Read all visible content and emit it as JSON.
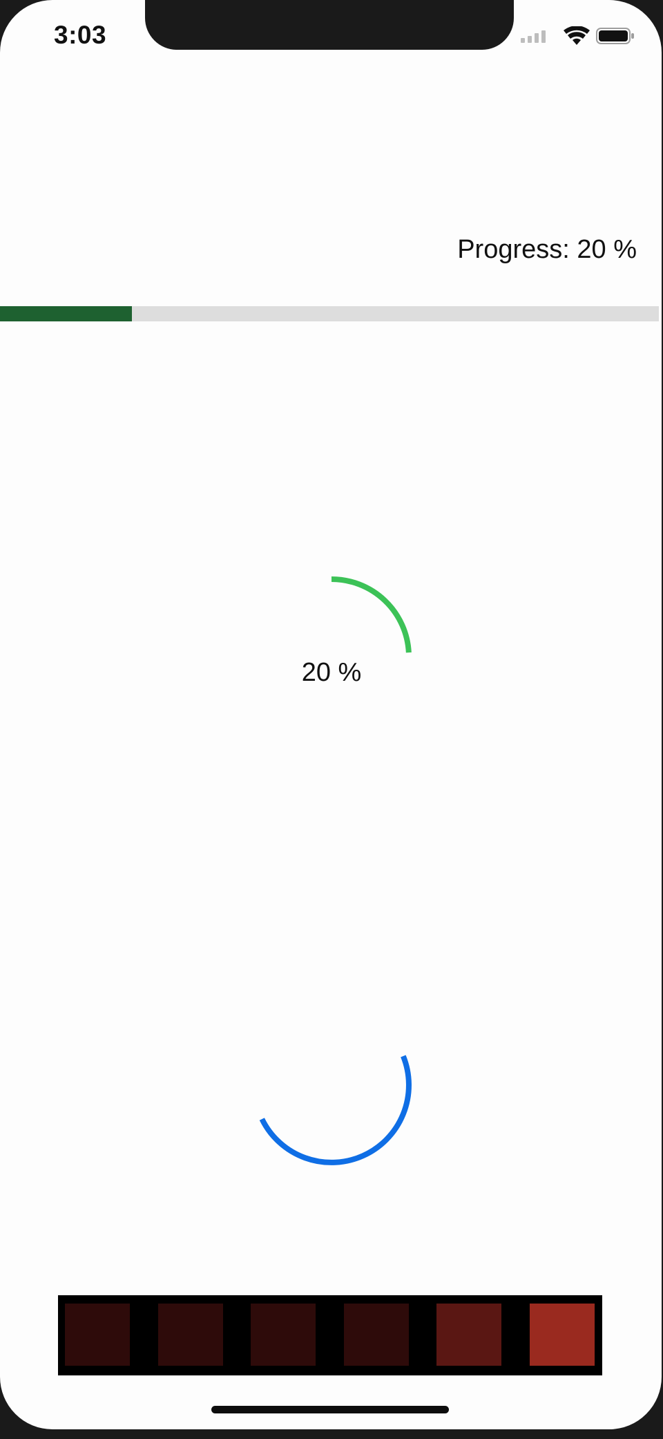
{
  "status_bar": {
    "time": "3:03",
    "signal_icon": "cellular-signal-icon",
    "wifi_icon": "wifi-icon",
    "battery_icon": "battery-icon"
  },
  "linear_progress": {
    "label": "Progress: 20 %",
    "value": 0.2,
    "track_color": "#dddddd",
    "fill_color": "#1e6130"
  },
  "circular_progress": {
    "label": "20 %",
    "value": 0.2,
    "color": "#3cc257"
  },
  "spinner": {
    "color": "#0f6ee5",
    "arc_fraction": 0.35
  },
  "color_blocks": {
    "colors": [
      "#2e0b0a",
      "#2e0b0a",
      "#2e0b0a",
      "#2e0b0a",
      "#5a1713",
      "#9a2a1f"
    ]
  }
}
